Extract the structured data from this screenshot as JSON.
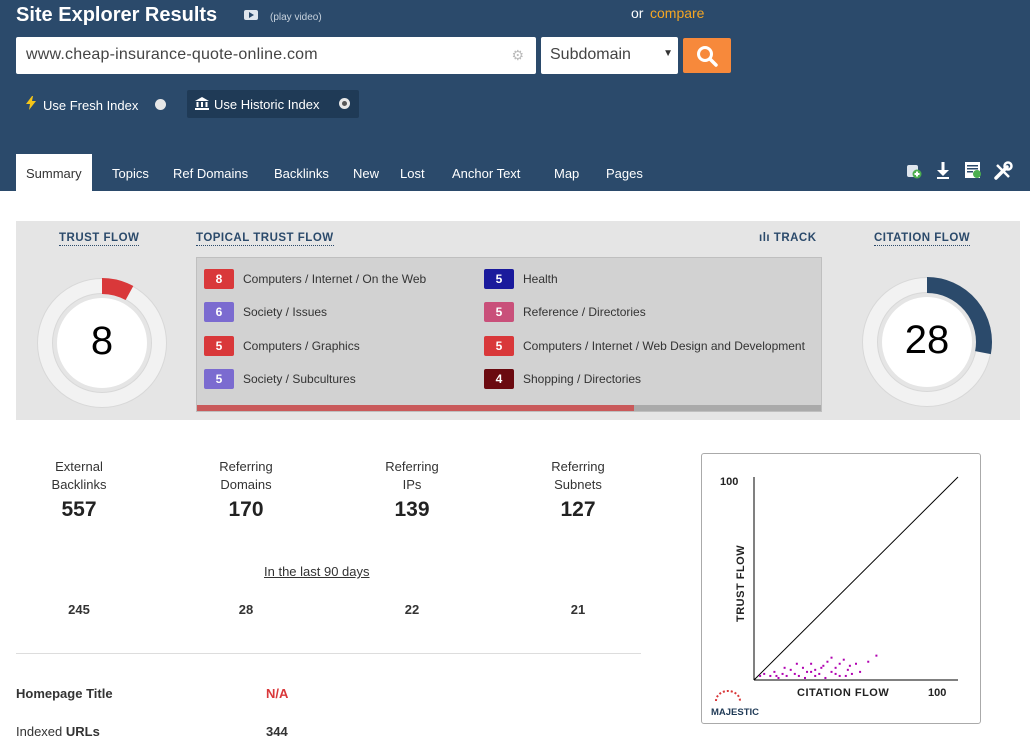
{
  "header": {
    "title": "Site Explorer Results",
    "play_video": "(play video)",
    "or_text": "or",
    "compare_label": "compare",
    "url_value": "www.cheap-insurance-quote-online.com",
    "scope_value": "Subdomain",
    "fresh_index_label": "Use Fresh Index",
    "historic_index_label": "Use Historic Index",
    "selected_index": "historic"
  },
  "tabs": [
    "Summary",
    "Topics",
    "Ref Domains",
    "Backlinks",
    "New",
    "Lost",
    "Anchor Text",
    "Map",
    "Pages"
  ],
  "active_tab": "Summary",
  "toolbar_icons": [
    "add-bucket-icon",
    "download-icon",
    "report-icon",
    "tools-icon"
  ],
  "metrics": {
    "trust_flow_label": "TRUST FLOW",
    "trust_flow_value": 8,
    "citation_flow_label": "CITATION FLOW",
    "citation_flow_value": 28,
    "topical_label": "TOPICAL TRUST FLOW",
    "track_label": "TRACK",
    "topics": [
      {
        "score": "8",
        "label": "Computers / Internet / On the Web",
        "color": "#d9383a"
      },
      {
        "score": "6",
        "label": "Society / Issues",
        "color": "#7b6bd0"
      },
      {
        "score": "5",
        "label": "Computers / Graphics",
        "color": "#d9383a"
      },
      {
        "score": "5",
        "label": "Society / Subcultures",
        "color": "#7b6bd0"
      },
      {
        "score": "5",
        "label": "Health",
        "color": "#1a1a9c"
      },
      {
        "score": "5",
        "label": "Reference / Directories",
        "color": "#c9507a"
      },
      {
        "score": "5",
        "label": "Computers / Internet / Web Design and Development",
        "color": "#d9383a"
      },
      {
        "score": "4",
        "label": "Shopping / Directories",
        "color": "#6b0a10"
      }
    ],
    "topic_scroll_fraction": 0.7
  },
  "stats": [
    {
      "label_line1": "External",
      "label_line2": "Backlinks",
      "value": "557",
      "last90": "245"
    },
    {
      "label_line1": "Referring",
      "label_line2": "Domains",
      "value": "170",
      "last90": "28"
    },
    {
      "label_line1": "Referring",
      "label_line2": "IPs",
      "value": "139",
      "last90": "22"
    },
    {
      "label_line1": "Referring",
      "label_line2": "Subnets",
      "value": "127",
      "last90": "21"
    }
  ],
  "last90_label": "In the last 90 days",
  "info": {
    "homepage_title_label": "Homepage Title",
    "homepage_title_value": "N/A",
    "indexed_urls_label_a": "Indexed ",
    "indexed_urls_label_b": "URLs",
    "indexed_urls_value": "344"
  },
  "chart_data": {
    "type": "scatter",
    "xlabel": "CITATION FLOW",
    "ylabel": "TRUST FLOW",
    "xlim": [
      0,
      100
    ],
    "ylim": [
      0,
      100
    ],
    "x_tick_label": "100",
    "y_tick_label": "100",
    "diagonal_reference": true,
    "point_color": "#b000b0",
    "logo_text": "MAJESTIC",
    "points": [
      [
        3,
        2
      ],
      [
        5,
        3
      ],
      [
        8,
        2
      ],
      [
        10,
        4
      ],
      [
        12,
        1
      ],
      [
        14,
        3
      ],
      [
        16,
        2
      ],
      [
        18,
        5
      ],
      [
        20,
        3
      ],
      [
        22,
        2
      ],
      [
        24,
        6
      ],
      [
        26,
        4
      ],
      [
        28,
        8
      ],
      [
        30,
        5
      ],
      [
        32,
        3
      ],
      [
        34,
        7
      ],
      [
        36,
        9
      ],
      [
        38,
        4
      ],
      [
        40,
        6
      ],
      [
        42,
        2
      ],
      [
        44,
        10
      ],
      [
        46,
        5
      ],
      [
        48,
        3
      ],
      [
        50,
        8
      ],
      [
        25,
        1
      ],
      [
        30,
        2
      ],
      [
        35,
        1
      ],
      [
        40,
        3
      ],
      [
        45,
        2
      ],
      [
        28,
        4
      ],
      [
        33,
        6
      ],
      [
        38,
        11
      ],
      [
        42,
        8
      ],
      [
        47,
        7
      ],
      [
        52,
        4
      ],
      [
        56,
        9
      ],
      [
        60,
        12
      ],
      [
        21,
        8
      ],
      [
        15,
        6
      ],
      [
        11,
        2
      ]
    ]
  }
}
